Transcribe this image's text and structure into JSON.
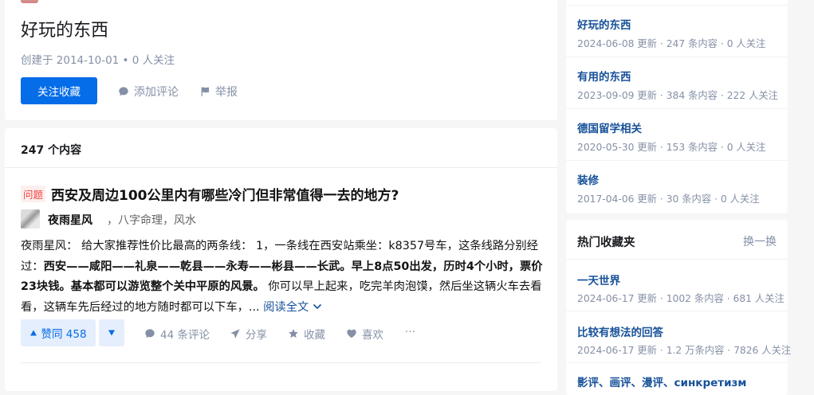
{
  "collection": {
    "title": "好玩的东西",
    "meta": "创建于 2014-10-01 • 0 人关注",
    "follow_label": "关注收藏",
    "comment_label": "添加评论",
    "report_label": "举报"
  },
  "list": {
    "count_label": "247 个内容",
    "item": {
      "badge": "问题",
      "title": "西安及周边100公里内有哪些冷门但非常值得一去的地方?",
      "author_name": "夜雨星风",
      "author_bio": "，八字命理，风水",
      "excerpt_plain1": "夜雨星风： 给大家推荐性价比最高的两条线： 1，一条线在西安站乘坐：k8357号车，这条线路分别经过：",
      "excerpt_bold": "西安——咸阳——礼泉——乾县——永寿——彬县——长武。早上8点50出发，历时4个小时，票价23块钱。基本都可以游览整个关中平原的风景。",
      "excerpt_plain2": " 你可以早上起来，吃完羊肉泡馍，然后坐这辆火车去看看，这辆车先后经过的地方随时都可以下车，... ",
      "read_more": "阅读全文",
      "vote_up": "赞同 458",
      "comments": "44 条评论",
      "share": "分享",
      "favorite": "收藏",
      "like": "喜欢",
      "more": "···"
    }
  },
  "sidebar_my": [
    {
      "title": "好玩的东西",
      "meta": "2024-06-08 更新 · 247 条内容 · 0 人关注"
    },
    {
      "title": "有用的东西",
      "meta": "2023-09-09 更新 · 384 条内容 · 222 人关注"
    },
    {
      "title": "德国留学相关",
      "meta": "2020-05-30 更新 · 153 条内容 · 0 人关注"
    },
    {
      "title": "装修",
      "meta": "2017-04-06 更新 · 30 条内容 · 0 人关注"
    }
  ],
  "sidebar_hot": {
    "title": "热门收藏夹",
    "refresh": "换一换",
    "items": [
      {
        "title": "一天世界",
        "meta": "2024-06-17 更新 · 1002 条内容 · 681 人关注"
      },
      {
        "title": "比较有想法的回答",
        "meta": "2024-06-17 更新 · 1.2 万条内容 · 7826 人关注"
      },
      {
        "title": "影评、画评、漫评、синкретизм",
        "meta": ""
      }
    ]
  },
  "colors": {
    "primary": "#056de8",
    "link": "#175199",
    "muted": "#8590a6",
    "badge": "#f1403c"
  }
}
